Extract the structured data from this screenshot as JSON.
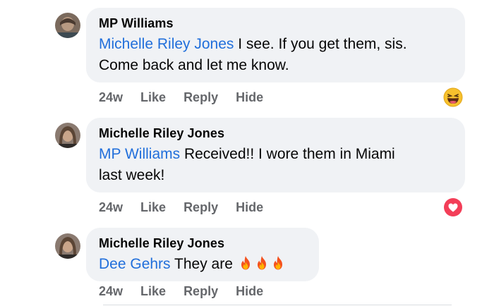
{
  "comments": [
    {
      "author": "MP Williams",
      "mention": "Michelle Riley Jones",
      "text_line1": " I see. If you get them, sis.",
      "text_line2": "Come back and let me know.",
      "time": "24w",
      "like": "Like",
      "reply": "Reply",
      "hide": "Hide",
      "reaction": "laughing-face-icon"
    },
    {
      "author": "Michelle Riley Jones",
      "mention": "MP Williams",
      "text_line1": " Received!! I wore them in Miami",
      "text_line2": "last week!",
      "time": "24w",
      "like": "Like",
      "reply": "Reply",
      "hide": "Hide",
      "reaction": "heart-icon"
    },
    {
      "author": "Michelle Riley Jones",
      "mention": "Dee Gehrs",
      "text_line1": " They are ",
      "emoji": "fire-icon x3",
      "time": "24w",
      "like": "Like",
      "reply": "Reply",
      "hide": "Hide"
    }
  ],
  "colors": {
    "bubble": "#f0f2f5",
    "mention": "#216fdb",
    "meta": "#65676b",
    "heart": "#f33e58"
  }
}
